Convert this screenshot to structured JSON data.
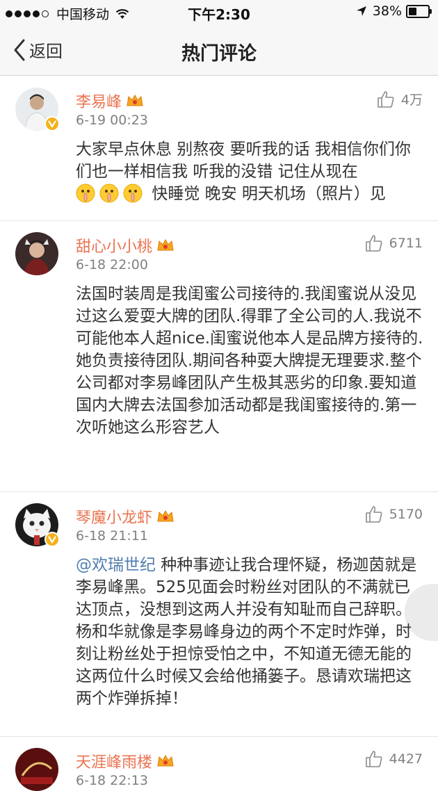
{
  "status_bar": {
    "carrier": "中国移动",
    "time": "下午2:30",
    "battery": "38%",
    "battery_level": 0.38
  },
  "nav": {
    "back_label": "返回",
    "title": "热门评论"
  },
  "comments": [
    {
      "username": "李易峰",
      "timestamp": "6-19 00:23",
      "likes": "4万",
      "text_main": "大家早点休息 别熬夜 要听我的话 我相信你们你们也一样相信我 听我的没错 记住从现在",
      "text_tail": "快睡觉 晚安 明天机场（照片）见"
    },
    {
      "username": "甜心小小桃",
      "timestamp": "6-18 22:00",
      "likes": "6711",
      "text": "法国时装周是我闺蜜公司接待的.我闺蜜说从没见过这么爱耍大牌的团队.得罪了全公司的人.我说不可能他本人超nice.闺蜜说他本人是品牌方接待的.她负责接待团队.期间各种耍大牌提无理要求.整个公司都对李易峰团队产生极其恶劣的印象.要知道国内大牌去法国参加活动都是我闺蜜接待的.第一次听她这么形容艺人"
    },
    {
      "username": "琴魔小龙虾",
      "timestamp": "6-18 21:11",
      "likes": "5170",
      "mention": "@欢瑞世纪",
      "text": " 种种事迹让我合理怀疑，杨迦茵就是李易峰黑。525见面会时粉丝对团队的不满就已达顶点，没想到这两人并没有知耻而自己辞职。杨和华就像是李易峰身边的两个不定时炸弹，时刻让粉丝处于担惊受怕之中，不知道无德无能的这两位什么时候又会给他捅篓子。恳请欢瑞把这两个炸弹拆掉！"
    },
    {
      "username": "天涯峰雨楼",
      "timestamp": "6-18 22:13",
      "likes": "4427"
    }
  ]
}
